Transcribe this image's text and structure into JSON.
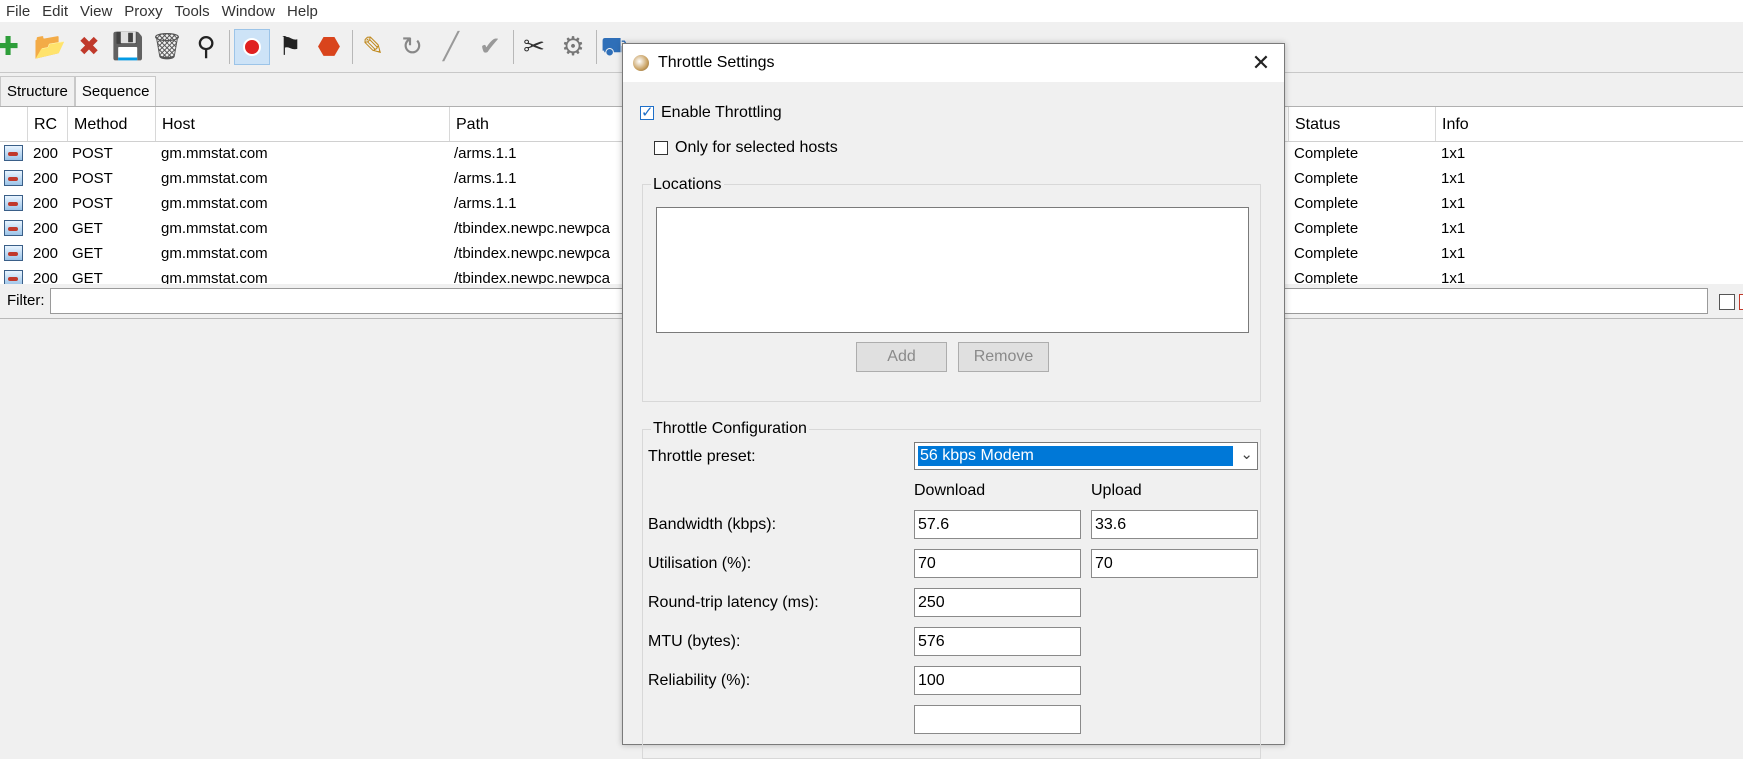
{
  "menu": [
    "File",
    "Edit",
    "View",
    "Proxy",
    "Tools",
    "Window",
    "Help"
  ],
  "toolbar_icons": [
    "new-session-icon",
    "open-session-icon",
    "close-session-icon",
    "save-icon",
    "trash-icon",
    "binoculars-find-icon",
    "record-icon",
    "start-flags-icon",
    "stop-icon",
    "edit-pencil-icon",
    "refresh-icon",
    "clear-line-icon",
    "validate-check-icon",
    "tools-icon",
    "settings-gear-icon",
    "throttle-icon"
  ],
  "tabs": [
    "Structure",
    "Sequence"
  ],
  "table": {
    "headers": [
      "RC",
      "Method",
      "Host",
      "Path",
      "Status",
      "Info"
    ],
    "rows": [
      {
        "rc": "200",
        "method": "POST",
        "host": "gm.mmstat.com",
        "path": "/arms.1.1",
        "status": "Complete",
        "info": "1x1"
      },
      {
        "rc": "200",
        "method": "POST",
        "host": "gm.mmstat.com",
        "path": "/arms.1.1",
        "status": "Complete",
        "info": "1x1"
      },
      {
        "rc": "200",
        "method": "POST",
        "host": "gm.mmstat.com",
        "path": "/arms.1.1",
        "status": "Complete",
        "info": "1x1"
      },
      {
        "rc": "200",
        "method": "GET",
        "host": "gm.mmstat.com",
        "path": "/tbindex.newpc.newpca",
        "status": "Complete",
        "info": "1x1"
      },
      {
        "rc": "200",
        "method": "GET",
        "host": "gm.mmstat.com",
        "path": "/tbindex.newpc.newpca",
        "status": "Complete",
        "info": "1x1"
      },
      {
        "rc": "200",
        "method": "GET",
        "host": "gm.mmstat.com",
        "path": "/tbindex.newpc.newpca",
        "status": "Complete",
        "info": "1x1"
      }
    ]
  },
  "filter": {
    "label": "Filter:",
    "value": ""
  },
  "dialog": {
    "title": "Throttle Settings",
    "enable_label": "Enable Throttling",
    "enable_checked": true,
    "selected_hosts_label": "Only for selected hosts",
    "selected_hosts_checked": false,
    "locations_title": "Locations",
    "add_label": "Add",
    "remove_label": "Remove",
    "config_title": "Throttle Configuration",
    "preset_label": "Throttle preset:",
    "preset_value": "56 kbps Modem",
    "download_label": "Download",
    "upload_label": "Upload",
    "bandwidth_label": "Bandwidth (kbps):",
    "bandwidth_down": "57.6",
    "bandwidth_up": "33.6",
    "utilisation_label": "Utilisation (%):",
    "utilisation_down": "70",
    "utilisation_up": "70",
    "latency_label": "Round-trip latency (ms):",
    "latency_value": "250",
    "mtu_label": "MTU (bytes):",
    "mtu_value": "576",
    "reliability_label": "Reliability (%):",
    "reliability_value": "100"
  }
}
